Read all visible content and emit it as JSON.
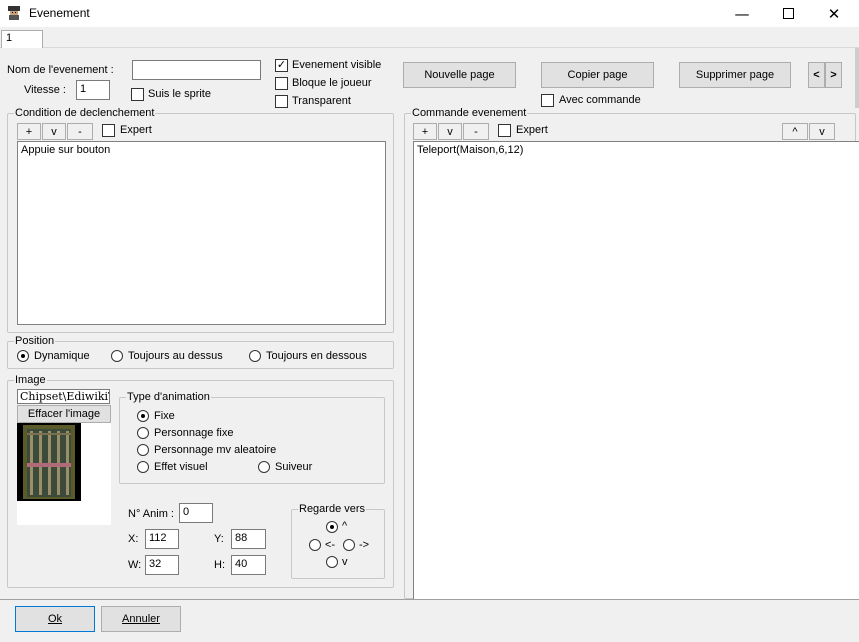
{
  "window": {
    "title": "Evenement",
    "tab_label": "1"
  },
  "event": {
    "name_label": "Nom de l'evenement :",
    "name_value": "",
    "speed_label": "Vitesse :",
    "speed_value": "1",
    "follow_sprite_label": "Suis le sprite",
    "follow_sprite_checked": false,
    "visible_label": "Evenement visible",
    "visible_checked": true,
    "block_label": "Bloque le joueur",
    "block_checked": false,
    "transparent_label": "Transparent",
    "transparent_checked": false
  },
  "pages": {
    "new_label": "Nouvelle page",
    "copy_label": "Copier page",
    "delete_label": "Supprimer page",
    "prev_label": "<",
    "next_label": ">",
    "with_command_label": "Avec commande",
    "with_command_checked": false
  },
  "condition": {
    "title": "Condition de declenchement",
    "add_label": "+",
    "down_label": "v",
    "remove_label": "-",
    "expert_label": "Expert",
    "expert_checked": false,
    "items": [
      "Appuie sur bouton"
    ]
  },
  "command": {
    "title": "Commande evenement",
    "add_label": "+",
    "down_label": "v",
    "remove_label": "-",
    "expert_label": "Expert",
    "expert_checked": false,
    "move_up_label": "^",
    "move_down_label": "v",
    "items": [
      "Teleport(Maison,6,12)"
    ]
  },
  "position": {
    "title": "Position",
    "options": [
      "Dynamique",
      "Toujours au dessus",
      "Toujours en dessous"
    ],
    "selected": "Dynamique"
  },
  "image": {
    "title": "Image",
    "path": "Chipset\\EdiwikiTu",
    "clear_label": "Effacer l'image",
    "anim_title": "Type d'animation",
    "anim_options": [
      "Fixe",
      "Personnage fixe",
      "Personnage mv aleatoire",
      "Effet visuel",
      "Suiveur"
    ],
    "anim_selected": "Fixe",
    "n_anim_label": "N° Anim :",
    "n_anim_value": "0",
    "x_label": "X:",
    "x_value": "112",
    "y_label": "Y:",
    "y_value": "88",
    "w_label": "W:",
    "w_value": "32",
    "h_label": "H:",
    "h_value": "40",
    "look_title": "Regarde vers",
    "look_up": "^",
    "look_left": "<-",
    "look_right": "->",
    "look_down": "v",
    "look_selected": "^"
  },
  "footer": {
    "ok_label": "Ok",
    "cancel_label": "Annuler"
  },
  "colors": {
    "door_frame": "#5a5a2a",
    "door_body": "#3c4a3a",
    "door_bars": "#9a8f6a",
    "sprite_bg": "#000000"
  }
}
